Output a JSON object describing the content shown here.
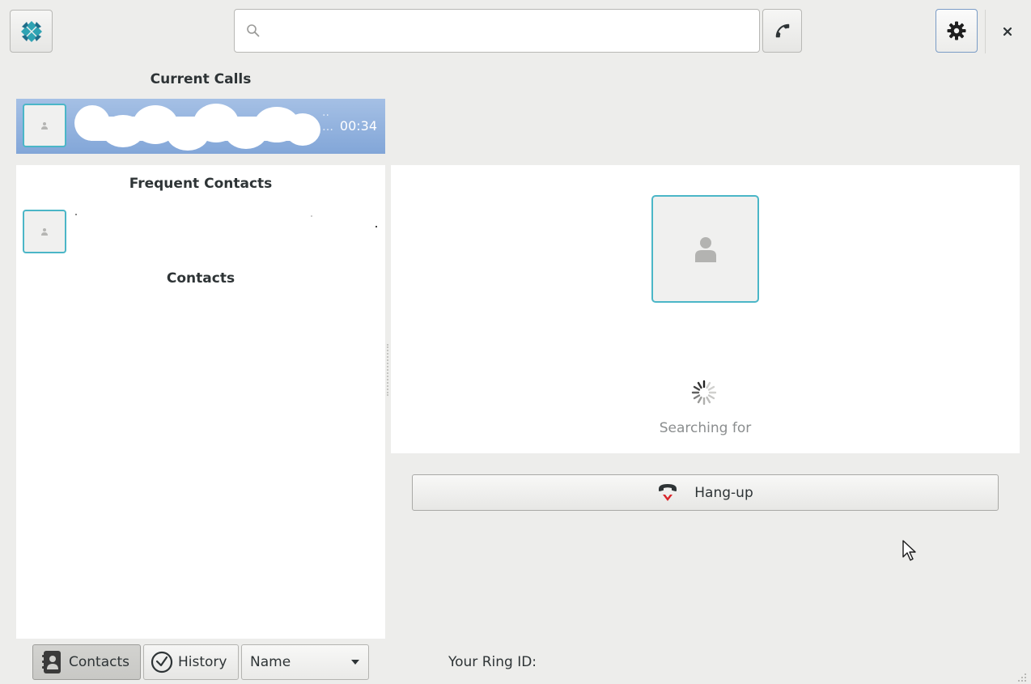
{
  "header": {
    "search_placeholder": "",
    "app_icon": "ring-logo-icon",
    "call_icon": "phone-icon",
    "settings_icon": "gear-icon",
    "close_icon": "close-icon"
  },
  "current_calls": {
    "title": "Current Calls",
    "calls": [
      {
        "duration": "00:34",
        "ellipsis": "…"
      }
    ]
  },
  "contacts_panel": {
    "frequent_title": "Frequent Contacts",
    "contacts_title": "Contacts"
  },
  "call_view": {
    "status": "Searching for",
    "hangup_label": "Hang-up"
  },
  "bottom_bar": {
    "contacts_tab": "Contacts",
    "history_tab": "History",
    "sort_value": "Name",
    "ring_id_label": "Your Ring ID:"
  },
  "colors": {
    "accent_border": "#4bb6c7",
    "selection": "#8eaedc",
    "hangup_red": "#d9262b"
  }
}
